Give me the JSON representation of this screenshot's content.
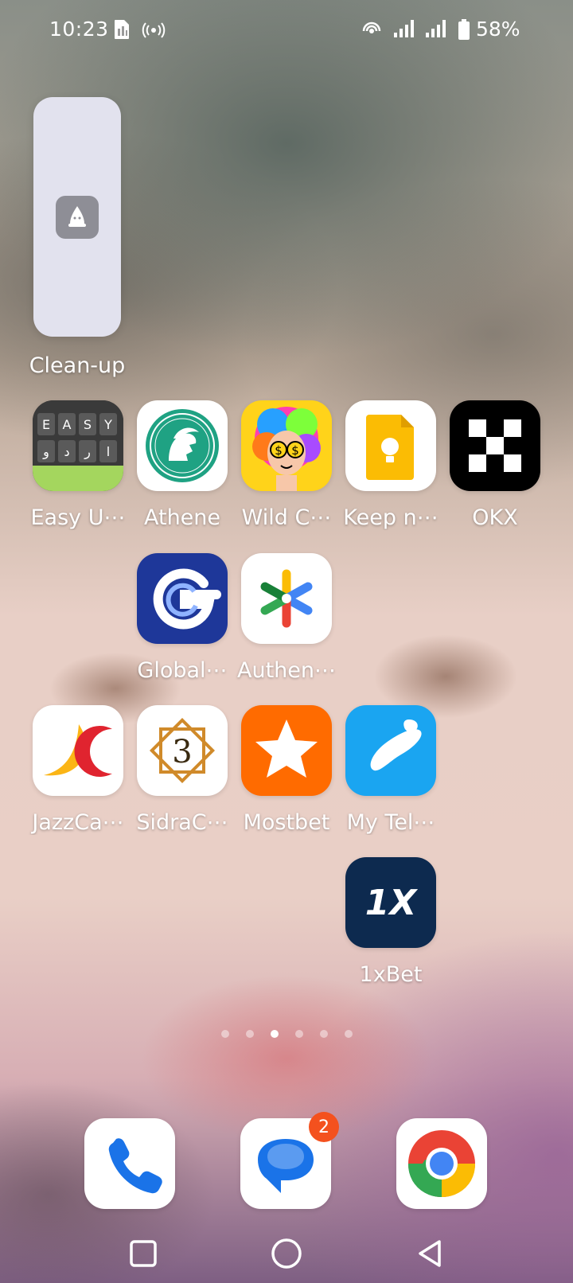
{
  "status_bar": {
    "time": "10:23",
    "battery_percent": "58%",
    "icons": [
      "sim-icon",
      "hotspot-icon",
      "wifi-icon",
      "signal-icon",
      "signal-icon",
      "battery-icon"
    ]
  },
  "widget": {
    "label": "Clean-up",
    "icon": "clean-up-icon"
  },
  "apps": [
    {
      "label": "Easy U⋯",
      "icon": "easy-urdu-keyboard-icon"
    },
    {
      "label": "Athene",
      "icon": "athene-icon"
    },
    {
      "label": "Wild C⋯",
      "icon": "wild-cash-icon"
    },
    {
      "label": "Keep n⋯",
      "icon": "keep-notes-icon"
    },
    {
      "label": "OKX",
      "icon": "okx-icon"
    },
    {
      "label": "Global⋯",
      "icon": "global-icon"
    },
    {
      "label": "Authen⋯",
      "icon": "authenticator-icon"
    },
    {
      "label": "JazzCa⋯",
      "icon": "jazzcash-icon"
    },
    {
      "label": "SidraC⋯",
      "icon": "sidra-chain-icon"
    },
    {
      "label": "Mostbet",
      "icon": "mostbet-icon"
    },
    {
      "label": "My Tel⋯",
      "icon": "my-telenor-icon"
    },
    {
      "label": "1xBet",
      "icon": "1xbet-icon"
    }
  ],
  "easy_keys": {
    "row1": [
      "E",
      "A",
      "S",
      "Y"
    ],
    "row2": [
      "و",
      "د",
      "ر",
      "ا"
    ]
  },
  "onexbet_logo": "1X",
  "page_indicator": {
    "count": 6,
    "active_index": 2
  },
  "dock": [
    {
      "icon": "phone-icon"
    },
    {
      "icon": "messages-icon",
      "badge": "2"
    },
    {
      "icon": "chrome-icon"
    }
  ],
  "nav": [
    "recents-button",
    "home-button",
    "back-button"
  ],
  "colors": {
    "okx": "#000000",
    "global": "#1e3799",
    "mostbet": "#ff6b00",
    "telenor": "#1aa5f1",
    "onexbet": "#0d2a4f",
    "keep": "#fbbc04",
    "messages_badge": "#f4511e"
  }
}
